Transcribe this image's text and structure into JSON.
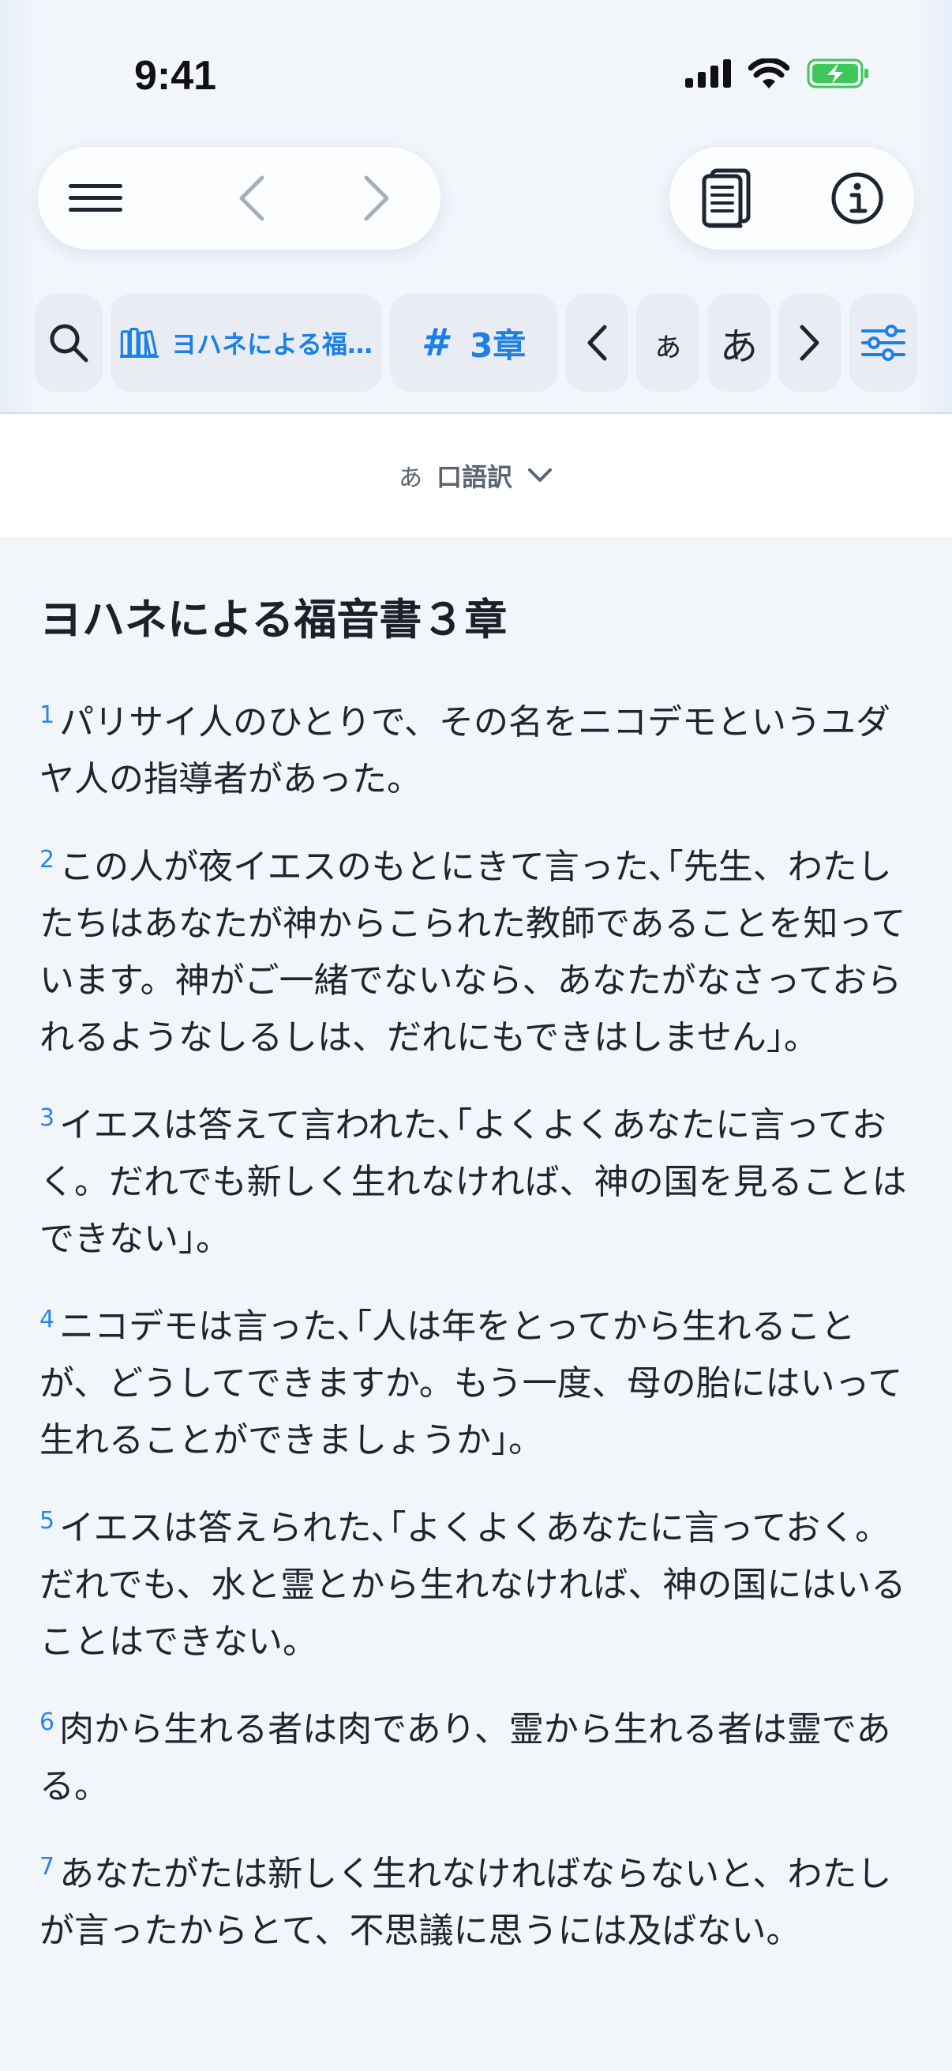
{
  "status_bar": {
    "time": "9:41"
  },
  "nav": {
    "menu_icon": "hamburger-icon",
    "back_icon": "chevron-left-icon",
    "forward_icon": "chevron-right-icon",
    "notes_icon": "document-icon",
    "info_icon": "info-icon"
  },
  "toolbar": {
    "book_label": "ヨハネによる福…",
    "chapter_symbol": "#",
    "chapter_label": "3章",
    "font_small_label": "ぁ",
    "font_large_label": "あ"
  },
  "translation": {
    "prefix": "あ",
    "name": "口語訳"
  },
  "content": {
    "chapter_title": "ヨハネによる福音書３章",
    "verses": [
      {
        "number": "1",
        "text": "パリサイ人のひとりで、その名をニコデモというユダヤ人の指導者があった。"
      },
      {
        "number": "2",
        "text": "この人が夜イエスのもとにきて言った､｢先生、わたしたちはあなたが神からこられた教師であることを知っています。神がご一緒でないなら、あなたがなさっておられるようなしるしは、だれにもできはしません」。"
      },
      {
        "number": "3",
        "text": "イエスは答えて言われた､｢よくよくあなたに言っておく。だれでも新しく生れなければ、神の国を見ることはできない」。"
      },
      {
        "number": "4",
        "text": "ニコデモは言った､｢人は年をとってから生れることが、どうしてできますか。もう一度、母の胎にはいって生れることができましょうか」。"
      },
      {
        "number": "5",
        "text": "イエスは答えられた､｢よくよくあなたに言っておく。だれでも、水と霊とから生れなければ、神の国にはいることはできない。"
      },
      {
        "number": "6",
        "text": "肉から生れる者は肉であり、霊から生れる者は霊である。"
      },
      {
        "number": "7",
        "text": "あなたがたは新しく生れなければならないと、わたしが言ったからとて、不思議に思うには及ばない。"
      }
    ]
  },
  "colors": {
    "accent": "#1d7fe8",
    "background": "#f2f5fa",
    "battery": "#3cc95a"
  }
}
